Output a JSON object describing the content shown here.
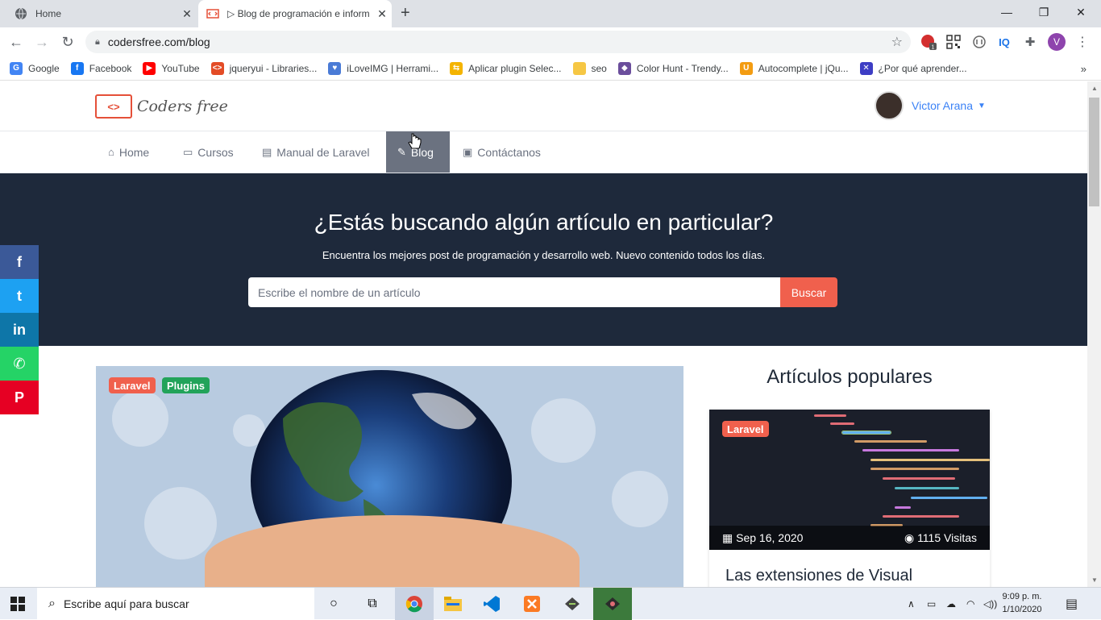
{
  "browser": {
    "tabs": [
      {
        "title": "Home",
        "active": false
      },
      {
        "title": "▷ Blog de programación e inform",
        "active": true
      }
    ],
    "url": "codersfree.com/blog",
    "bookmarks": [
      {
        "label": "Google",
        "color": "#4285f4",
        "glyph": "G"
      },
      {
        "label": "Facebook",
        "color": "#1877f2",
        "glyph": "f"
      },
      {
        "label": "YouTube",
        "color": "#ff0000",
        "glyph": "▶"
      },
      {
        "label": "jqueryui - Libraries...",
        "color": "#e34c26",
        "glyph": "<>"
      },
      {
        "label": "iLoveIMG | Herrami...",
        "color": "#4a7bd6",
        "glyph": "♥"
      },
      {
        "label": "Aplicar plugin Selec...",
        "color": "#f4b400",
        "glyph": "⇆"
      },
      {
        "label": "seo",
        "color": "#f6c744",
        "glyph": ""
      },
      {
        "label": "Color Hunt - Trendy...",
        "color": "#6b4e9c",
        "glyph": "◆"
      },
      {
        "label": "Autocomplete | jQu...",
        "color": "#f39c12",
        "glyph": "U"
      },
      {
        "label": "¿Por qué aprender...",
        "color": "#3d3dc4",
        "glyph": "✕"
      }
    ],
    "extensions": {
      "badge": "1",
      "profile_initial": "V",
      "iq_label": "IQ"
    }
  },
  "site": {
    "logo_text": "Coders free",
    "logo_mark": "<>",
    "user_name": "Victor Arana",
    "nav": [
      {
        "label": "Home",
        "icon": "⌂",
        "active": false
      },
      {
        "label": "Cursos",
        "icon": "▭",
        "active": false
      },
      {
        "label": "Manual de Laravel",
        "icon": "▤",
        "active": false
      },
      {
        "label": "Blog",
        "icon": "✎",
        "active": true
      },
      {
        "label": "Contáctanos",
        "icon": "▣",
        "active": false
      }
    ],
    "hero": {
      "title": "¿Estás buscando algún artículo en particular?",
      "subtitle": "Encuentra los mejores post de programación y desarrollo web. Nuevo contenido todos los días.",
      "search_placeholder": "Escribe el nombre de un artículo",
      "search_button": "Buscar"
    },
    "share": [
      {
        "network": "facebook",
        "glyph": "f",
        "color": "#3b5998"
      },
      {
        "network": "twitter",
        "glyph": "t",
        "color": "#1da1f2"
      },
      {
        "network": "linkedin",
        "glyph": "in",
        "color": "#0e76a8"
      },
      {
        "network": "whatsapp",
        "glyph": "✆",
        "color": "#25d366"
      },
      {
        "network": "pinterest",
        "glyph": "P",
        "color": "#e60023"
      }
    ],
    "featured": {
      "tags": [
        {
          "label": "Laravel",
          "color": "#f0604d"
        },
        {
          "label": "Plugins",
          "color": "#22a35a"
        }
      ]
    },
    "popular": {
      "title": "Artículos populares",
      "card": {
        "tag": "Laravel",
        "date": "Sep 16, 2020",
        "views": "1115 Visitas",
        "title": "Las extensiones de Visual"
      }
    }
  },
  "taskbar": {
    "search_placeholder": "Escribe aquí para buscar",
    "time": "9:09 p. m.",
    "date": "1/10/2020"
  }
}
